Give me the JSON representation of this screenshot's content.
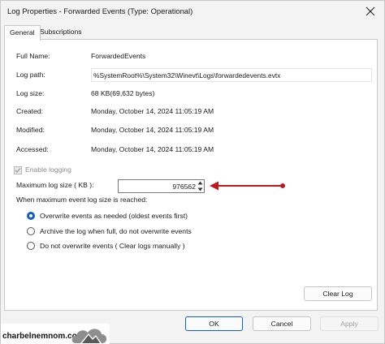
{
  "window": {
    "title": "Log Properties - Forwarded Events (Type: Operational)"
  },
  "tabs": [
    {
      "label": "General"
    },
    {
      "label": "Subscriptions"
    }
  ],
  "general": {
    "full_name": {
      "label": "Full Name:",
      "value": "ForwardedEvents"
    },
    "log_path": {
      "label": "Log path:",
      "value": "%SystemRoot%\\System32\\Winevt\\Logs\\forwardedevents.evtx"
    },
    "log_size": {
      "label": "Log size:",
      "value": "68 KB(69,632 bytes)"
    },
    "created": {
      "label": "Created:",
      "value": "Monday, October 14, 2024 11:05:19 AM"
    },
    "modified": {
      "label": "Modified:",
      "value": "Monday, October 14, 2024 11:05:19 AM"
    },
    "accessed": {
      "label": "Accessed:",
      "value": "Monday, October 14, 2024 11:05:19 AM"
    },
    "enable_logging": {
      "label": "Enable logging",
      "checked": true,
      "disabled": true
    },
    "max_log_size": {
      "label": "Maximum log size ( KB ):",
      "value": "976562"
    },
    "when_max_label": "When maximum event log size is reached:",
    "options": [
      {
        "label": "Overwrite events as needed (oldest events first)",
        "selected": true
      },
      {
        "label": "Archive the log when full, do not overwrite events",
        "selected": false
      },
      {
        "label": "Do not overwrite events ( Clear logs manually )",
        "selected": false
      }
    ],
    "clear_log_label": "Clear Log"
  },
  "footer": {
    "ok_label": "OK",
    "cancel_label": "Cancel",
    "apply_label": "Apply"
  },
  "watermark": {
    "text": "charbelnemnom.com"
  },
  "colors": {
    "accent": "#0f5fc0",
    "annotation_arrow": "#c0171f"
  }
}
